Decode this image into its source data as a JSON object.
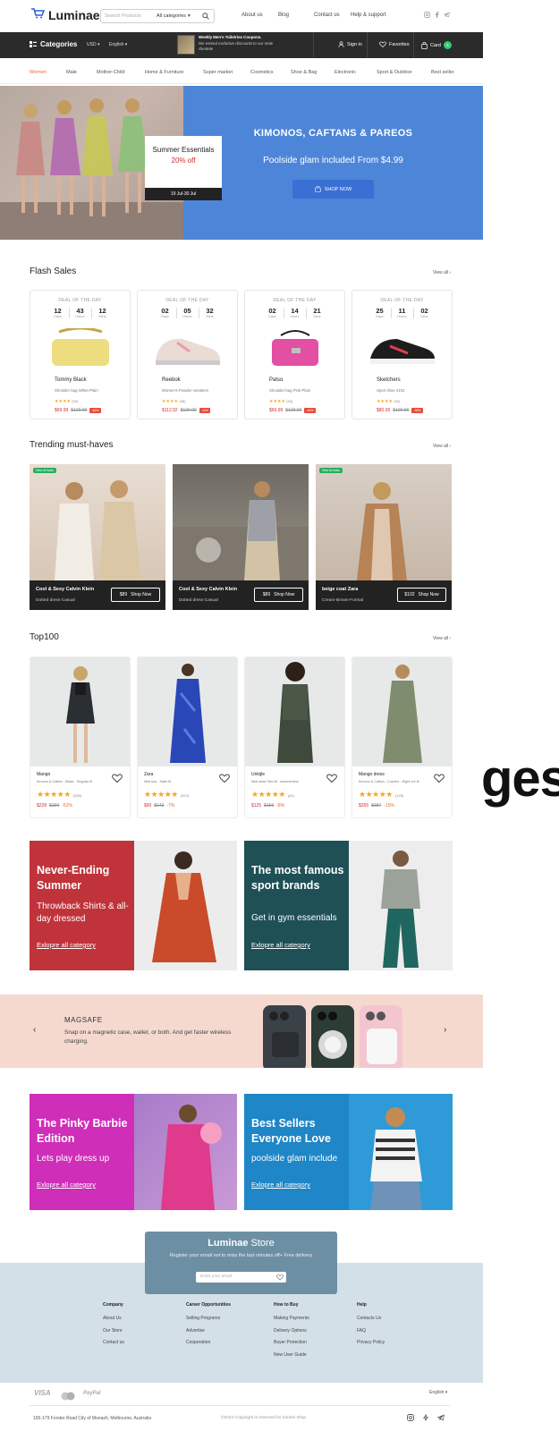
{
  "header": {
    "logo": "Luminae",
    "search_placeholder": "Search Products",
    "search_category": "All categories",
    "links": [
      "About us",
      "Blog",
      "Contact us",
      "Help & support"
    ]
  },
  "nav": {
    "categories": "Categories",
    "currency": "USD",
    "language": "English",
    "promo_title": "Weekly Men's Toiletries Coupons.",
    "promo_text": "We extend exclusive discounts to our male clientele",
    "sign_in": "Sign in",
    "favorites": "Favorites",
    "cart": "Card",
    "cart_count": "5"
  },
  "category_tabs": [
    "Women",
    "Male",
    "Mother-Child",
    "Home & Furniture",
    "Super market",
    "Cosmetics",
    "Shoe & Bag",
    "Electronic",
    "Sport & Outdoor",
    "Best seller"
  ],
  "hero": {
    "card_title": "Summer Essentials",
    "card_offer": "20% off",
    "card_date": "19 Jul-30 Jul",
    "headline": "KIMONOS, CAFTANS & PAREOS",
    "subline": "Poolside glam included From $4.99",
    "button": "SHOP NOW"
  },
  "flash": {
    "title": "Flash Sales",
    "view_all": "View all",
    "deal_label": "DEAL OF THE DAY",
    "units": [
      "Days",
      "Hours",
      "Mins"
    ],
    "items": [
      {
        "t": [
          "12",
          "43",
          "12"
        ],
        "brand": "Tommy Black",
        "desc": "Shoulder bag White-Plain",
        "count": "(34)",
        "price": "$69.99",
        "old": "$129.99",
        "badge": "-46%"
      },
      {
        "t": [
          "02",
          "05",
          "32"
        ],
        "brand": "Reebok",
        "desc": "Women's Powder sneakers",
        "count": "(36)",
        "price": "$112.02",
        "old": "$129.99",
        "badge": "-14%"
      },
      {
        "t": [
          "02",
          "14",
          "21"
        ],
        "brand": "Patso",
        "desc": "Shoulder bag Pink-Plain",
        "count": "(34)",
        "price": "$69.99",
        "old": "$129.99",
        "badge": "-46%"
      },
      {
        "t": [
          "25",
          "11",
          "02"
        ],
        "brand": "Sketchers",
        "desc": "Sport shoe 2102",
        "count": "(34)",
        "price": "$80.00",
        "old": "$129.99",
        "badge": "-38%"
      }
    ]
  },
  "trending": {
    "title": "Trending must-haves",
    "view_all": "View all",
    "new_badge": "New Arrivals",
    "shop_now": "Shop Now",
    "items": [
      {
        "name": "Cool & Sexy Calvin Klein",
        "sub": "Dotted dress-Casual",
        "price": "$89"
      },
      {
        "name": "Cool & Sexy Calvin Klein",
        "sub": "Dotted dress-Casual",
        "price": "$89"
      },
      {
        "name": "beige coat Zara",
        "sub": "Cream-Brown-Formal",
        "price": "$102"
      }
    ]
  },
  "top100": {
    "title": "Top100",
    "view_all": "View all",
    "items": [
      {
        "brand": "Mango",
        "desc": "Kimono & Caftan - Black - Regular fit",
        "count": "(289)",
        "price": "$228",
        "old": "$290",
        "pct": "-52%"
      },
      {
        "brand": "Zara",
        "desc": "Midi sea - Satin fit",
        "count": "(323)",
        "price": "$90",
        "old": "$143",
        "pct": "-7%"
      },
      {
        "brand": "Unkijle",
        "desc": "Midi wear Slim fit - summertime",
        "count": "(84)",
        "price": "$125",
        "old": "$156",
        "pct": "-8%"
      },
      {
        "brand": "Mango dress",
        "desc": "Kimono & Caftan - Colorful - Right cut fit",
        "count": "(125)",
        "price": "$265",
        "old": "$387",
        "pct": "-15%"
      }
    ]
  },
  "banners": [
    {
      "title": "Never-Ending Summer",
      "sub": "Throwback Shirts & all-day dressed",
      "link": "Exlopre all category",
      "color": "#c0333a"
    },
    {
      "title": "The most famous sport brands",
      "sub": "Get in gym essentials",
      "link": "Exlopre all category",
      "color": "#1e5056"
    },
    {
      "title": "The Pinky Barbie Edition",
      "sub": "Lets play dress up",
      "link": "Exlopre all category",
      "color": "#cf2eb8"
    },
    {
      "title": "Best Sellers Everyone Love",
      "sub": "poolside glam include",
      "link": "Exlopre all category",
      "color": "#1f86c7"
    }
  ],
  "magsafe": {
    "title": "MAGSAFE",
    "text": "Snap on a magnetic case, wallet, or both. And get faster wireless charging."
  },
  "newsletter": {
    "brand": "Luminae",
    "store": "Store",
    "text": "Register your email not to miss the last minutes off+ Free delivery",
    "placeholder": "Enter your email"
  },
  "footer": {
    "columns": [
      {
        "head": "Company",
        "items": [
          "About Us",
          "Our Store",
          "Contact us"
        ]
      },
      {
        "head": "Career Opportunities",
        "items": [
          "Selling Programs",
          "Advertise",
          "Cooperation"
        ]
      },
      {
        "head": "How to Buy",
        "items": [
          "Making Payments",
          "Delivery Options",
          "Buyer Protection",
          "New User Guide"
        ]
      },
      {
        "head": "Help",
        "items": [
          "Contacts Us",
          "FAQ",
          "Privacy Policy"
        ]
      }
    ],
    "payments": [
      "VISA",
      "PayPal"
    ],
    "language": "English",
    "address": "165-179 Forster Road City of Monash, Melbourne, Australia",
    "copyright": "©2023 Copyright is reserved for lumine shop"
  },
  "overlay_text": "ges"
}
